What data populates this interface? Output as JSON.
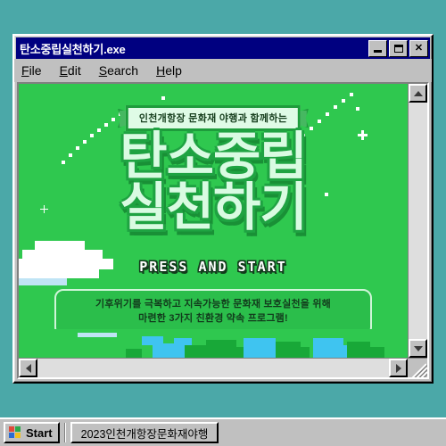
{
  "desktop": {
    "background_color": "#4BA8A8"
  },
  "window": {
    "title": "탄소중립실천하기.exe",
    "title_bar_color": "#000080",
    "controls": [
      {
        "name": "minimize",
        "glyph": "_"
      },
      {
        "name": "maximize",
        "glyph": "□"
      },
      {
        "name": "close",
        "glyph": "✕"
      }
    ],
    "menu": [
      {
        "accel": "F",
        "rest": "ile"
      },
      {
        "accel": "E",
        "rest": "dit"
      },
      {
        "accel": "S",
        "rest": "earch"
      },
      {
        "accel": "H",
        "rest": "elp"
      }
    ]
  },
  "canvas": {
    "background_color": "#2FC84F",
    "ribbon_text": "인천개항장 문화재 야행과 함께하는",
    "title_line_1": "탄소중립",
    "title_line_2": "실천하기",
    "title_fill_color": "#D9FBE2",
    "title_shadow_color": "#1FA342",
    "press_start": "PRESS AND START",
    "description_line_1": "기후위기를 극복하고 지속가능한 문화재 보호실천을 위해",
    "description_line_2": "마련한 3가지 친환경 약속 프로그램!",
    "description_box_color": "#2BBE4B",
    "landscape_colors": {
      "grass": "#2FC84F",
      "dark_grass": "#18A838",
      "water": "#3FC4F0",
      "cloud": "#FFFFFF"
    }
  },
  "scrollbars": {
    "vertical": {
      "up": "▲",
      "down": "▼"
    },
    "horizontal": {
      "left": "◄",
      "right": "►"
    }
  },
  "taskbar": {
    "start_label": "Start",
    "task_button_label": "2023인천개항장문화재야행",
    "logo_colors": [
      "#E04A3A",
      "#2BA84A",
      "#2B6CD4",
      "#F0C020"
    ]
  }
}
